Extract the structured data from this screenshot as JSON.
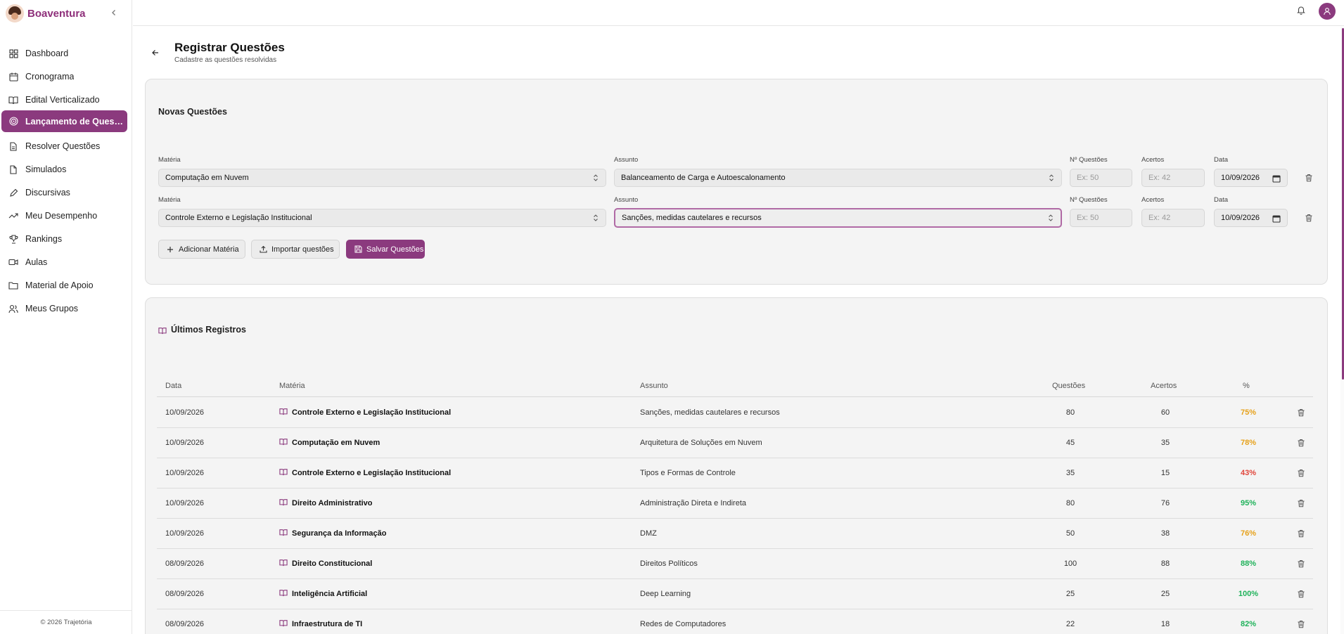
{
  "brand": {
    "name": "Boaventura"
  },
  "sidebar": {
    "items": [
      {
        "label": "Dashboard",
        "icon": "grid-icon",
        "active": false
      },
      {
        "label": "Cronograma",
        "icon": "calendar-icon",
        "active": false
      },
      {
        "label": "Edital Verticalizado",
        "icon": "book-open-icon",
        "active": false
      },
      {
        "label": "Lançamento de Questõ...",
        "icon": "target-icon",
        "active": true
      },
      {
        "label": "Resolver Questões",
        "icon": "file-text-icon",
        "active": false
      },
      {
        "label": "Simulados",
        "icon": "file-icon",
        "active": false
      },
      {
        "label": "Discursivas",
        "icon": "pen-icon",
        "active": false
      },
      {
        "label": "Meu Desempenho",
        "icon": "trending-up-icon",
        "active": false
      },
      {
        "label": "Rankings",
        "icon": "trophy-icon",
        "active": false
      },
      {
        "label": "Aulas",
        "icon": "video-icon",
        "active": false
      },
      {
        "label": "Material de Apoio",
        "icon": "folder-icon",
        "active": false
      },
      {
        "label": "Meus Grupos",
        "icon": "users-icon",
        "active": false
      }
    ],
    "footer": "© 2026 Trajetória"
  },
  "header": {
    "title": "Registrar Questões",
    "subtitle": "Cadastre as questões resolvidas"
  },
  "form": {
    "title": "Novas Questões",
    "labels": {
      "materia": "Matéria",
      "assunto": "Assunto",
      "n_questoes": "Nº Questões",
      "acertos": "Acertos",
      "data": "Data"
    },
    "rows": [
      {
        "materia": "Computação em Nuvem",
        "assunto": "Balanceamento de Carga e Autoescalonamento",
        "n_questoes_placeholder": "Ex: 50",
        "acertos_placeholder": "Ex: 42",
        "data": "10/09/2026"
      },
      {
        "materia": "Controle Externo e Legislação Institucional",
        "assunto": "Sanções, medidas cautelares e recursos",
        "n_questoes_placeholder": "Ex: 50",
        "acertos_placeholder": "Ex: 42",
        "data": "10/09/2026"
      }
    ],
    "buttons": {
      "add": "Adicionar Matéria",
      "import": "Importar questões",
      "save": "Salvar Questões"
    }
  },
  "records": {
    "title": "Últimos Registros",
    "columns": [
      "Data",
      "Matéria",
      "Assunto",
      "Questões",
      "Acertos",
      "%"
    ],
    "rows": [
      {
        "data": "10/09/2026",
        "materia": "Controle Externo e Legislação Institucional",
        "assunto": "Sanções, medidas cautelares e recursos",
        "questoes": "80",
        "acertos": "60",
        "pct": "75%",
        "pct_color": "#e6a11a"
      },
      {
        "data": "10/09/2026",
        "materia": "Computação em Nuvem",
        "assunto": "Arquitetura de Soluções em Nuvem",
        "questoes": "45",
        "acertos": "35",
        "pct": "78%",
        "pct_color": "#e6a11a"
      },
      {
        "data": "10/09/2026",
        "materia": "Controle Externo e Legislação Institucional",
        "assunto": "Tipos e Formas de Controle",
        "questoes": "35",
        "acertos": "15",
        "pct": "43%",
        "pct_color": "#e0463b"
      },
      {
        "data": "10/09/2026",
        "materia": "Direito Administrativo",
        "assunto": "Administração Direta e Indireta",
        "questoes": "80",
        "acertos": "76",
        "pct": "95%",
        "pct_color": "#1fb25a"
      },
      {
        "data": "10/09/2026",
        "materia": "Segurança da Informação",
        "assunto": "DMZ",
        "questoes": "50",
        "acertos": "38",
        "pct": "76%",
        "pct_color": "#e6a11a"
      },
      {
        "data": "08/09/2026",
        "materia": "Direito Constitucional",
        "assunto": "Direitos Políticos",
        "questoes": "100",
        "acertos": "88",
        "pct": "88%",
        "pct_color": "#1fb25a"
      },
      {
        "data": "08/09/2026",
        "materia": "Inteligência Artificial",
        "assunto": "Deep Learning",
        "questoes": "25",
        "acertos": "25",
        "pct": "100%",
        "pct_color": "#1fb25a"
      },
      {
        "data": "08/09/2026",
        "materia": "Infraestrutura de TI",
        "assunto": "Redes de Computadores",
        "questoes": "22",
        "acertos": "18",
        "pct": "82%",
        "pct_color": "#1fb25a"
      }
    ]
  },
  "colors": {
    "accent": "#8b3a7e",
    "brand": "#8e2f7a"
  }
}
